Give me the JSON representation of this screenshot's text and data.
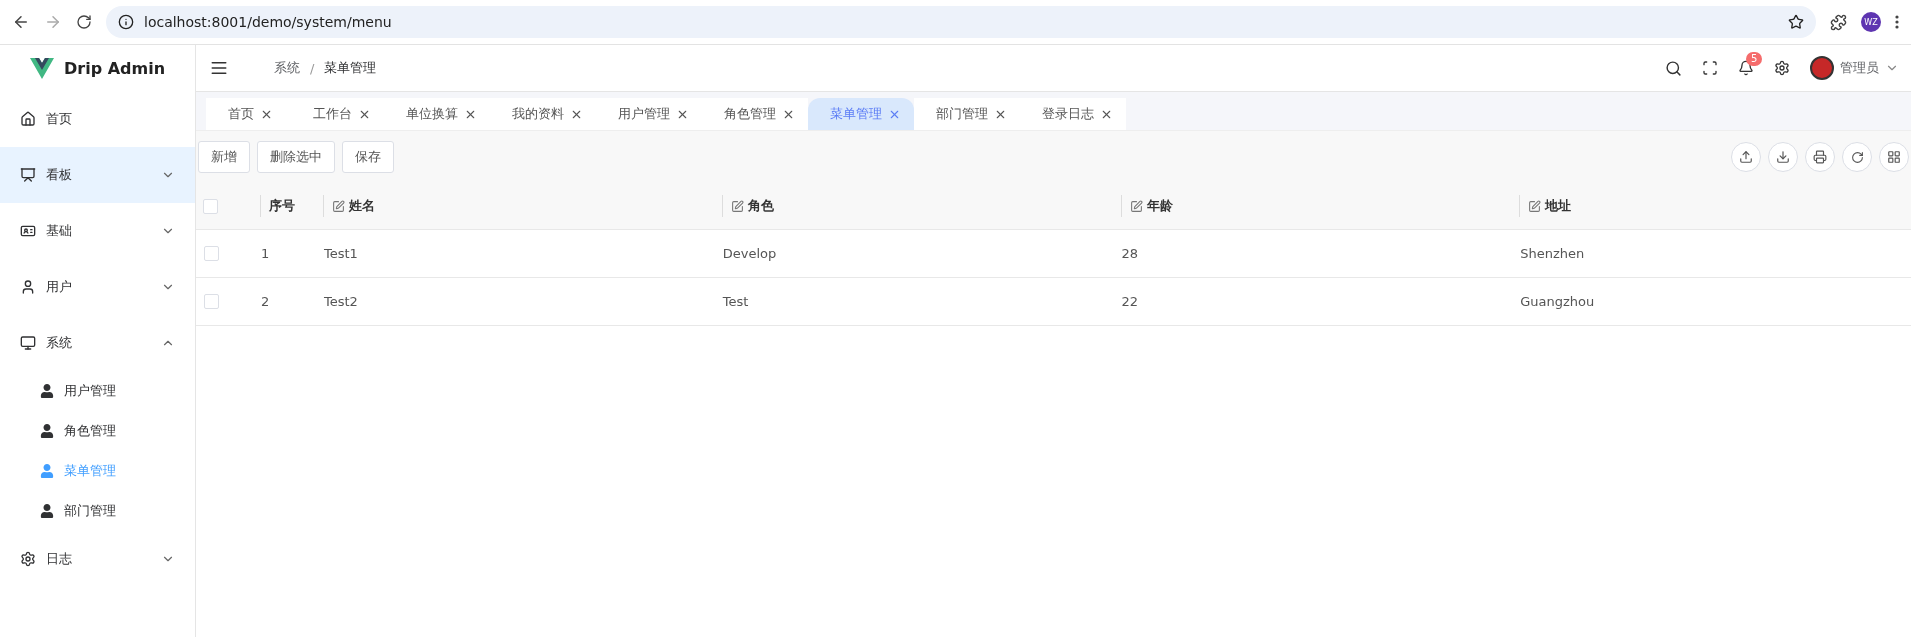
{
  "browser": {
    "url": "localhost:8001/demo/system/menu",
    "profile": "WZ"
  },
  "app": {
    "logo": "Drip Admin"
  },
  "sidebar": {
    "items": [
      {
        "label": "首页",
        "highlighted": false
      },
      {
        "label": "看板",
        "highlighted": true,
        "expanded": false
      },
      {
        "label": "基础",
        "highlighted": false,
        "expanded": false
      },
      {
        "label": "用户",
        "highlighted": false,
        "expanded": false
      },
      {
        "label": "系统",
        "highlighted": false,
        "expanded": true,
        "children": [
          {
            "label": "用户管理",
            "selected": false
          },
          {
            "label": "角色管理",
            "selected": false
          },
          {
            "label": "菜单管理",
            "selected": true
          },
          {
            "label": "部门管理",
            "selected": false
          }
        ]
      },
      {
        "label": "日志",
        "highlighted": false,
        "expanded": false
      }
    ]
  },
  "header": {
    "breadcrumb": [
      "系统",
      "菜单管理"
    ],
    "breadcrumb_separator": "/",
    "notifications": "5",
    "user": "管理员"
  },
  "tabs": [
    {
      "label": "首页",
      "selected": false
    },
    {
      "label": "工作台",
      "selected": false
    },
    {
      "label": "单位换算",
      "selected": false
    },
    {
      "label": "我的资料",
      "selected": false
    },
    {
      "label": "用户管理",
      "selected": false
    },
    {
      "label": "角色管理",
      "selected": false
    },
    {
      "label": "菜单管理",
      "selected": true
    },
    {
      "label": "部门管理",
      "selected": false
    },
    {
      "label": "登录日志",
      "selected": false
    }
  ],
  "toolbar": {
    "buttons": [
      "新增",
      "删除选中",
      "保存"
    ]
  },
  "table": {
    "all_checked": false,
    "columns": [
      {
        "label": "序号",
        "editable": false
      },
      {
        "label": "姓名",
        "editable": true
      },
      {
        "label": "角色",
        "editable": true
      },
      {
        "label": "年龄",
        "editable": true
      },
      {
        "label": "地址",
        "editable": true
      }
    ],
    "rows": [
      {
        "checked": false,
        "cells": [
          "1",
          "Test1",
          "Develop",
          "28",
          "Shenzhen"
        ]
      },
      {
        "checked": false,
        "cells": [
          "2",
          "Test2",
          "Test",
          "22",
          "Guangzhou"
        ]
      }
    ]
  }
}
